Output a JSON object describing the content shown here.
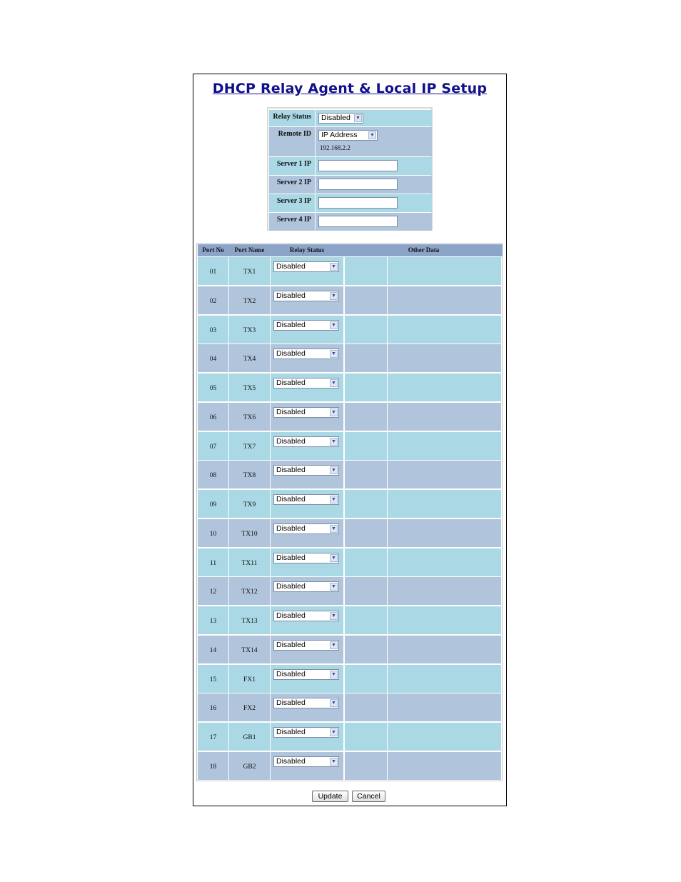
{
  "title": "DHCP Relay Agent & Local IP Setup",
  "setup": {
    "relay_status_label": "Relay Status",
    "relay_status_value": "Disabled",
    "remote_id_label": "Remote ID",
    "remote_id_type": "IP Address",
    "remote_id_value": "192.168.2.2",
    "server1_label": "Server 1 IP",
    "server2_label": "Server 2 IP",
    "server3_label": "Server 3 IP",
    "server4_label": "Server 4 IP"
  },
  "table": {
    "headers": {
      "port_no": "Port No",
      "port_name": "Port Name",
      "relay_status": "Relay Status",
      "other_data": "Other Data"
    },
    "rows": [
      {
        "port_no": "01",
        "port_name": "TX1",
        "relay_status": "Disabled"
      },
      {
        "port_no": "02",
        "port_name": "TX2",
        "relay_status": "Disabled"
      },
      {
        "port_no": "03",
        "port_name": "TX3",
        "relay_status": "Disabled"
      },
      {
        "port_no": "04",
        "port_name": "TX4",
        "relay_status": "Disabled"
      },
      {
        "port_no": "05",
        "port_name": "TX5",
        "relay_status": "Disabled"
      },
      {
        "port_no": "06",
        "port_name": "TX6",
        "relay_status": "Disabled"
      },
      {
        "port_no": "07",
        "port_name": "TX7",
        "relay_status": "Disabled"
      },
      {
        "port_no": "08",
        "port_name": "TX8",
        "relay_status": "Disabled"
      },
      {
        "port_no": "09",
        "port_name": "TX9",
        "relay_status": "Disabled"
      },
      {
        "port_no": "10",
        "port_name": "TX10",
        "relay_status": "Disabled"
      },
      {
        "port_no": "11",
        "port_name": "TX11",
        "relay_status": "Disabled"
      },
      {
        "port_no": "12",
        "port_name": "TX12",
        "relay_status": "Disabled"
      },
      {
        "port_no": "13",
        "port_name": "TX13",
        "relay_status": "Disabled"
      },
      {
        "port_no": "14",
        "port_name": "TX14",
        "relay_status": "Disabled"
      },
      {
        "port_no": "15",
        "port_name": "FX1",
        "relay_status": "Disabled"
      },
      {
        "port_no": "16",
        "port_name": "FX2",
        "relay_status": "Disabled"
      },
      {
        "port_no": "17",
        "port_name": "GB1",
        "relay_status": "Disabled"
      },
      {
        "port_no": "18",
        "port_name": "GB2",
        "relay_status": "Disabled"
      }
    ]
  },
  "buttons": {
    "update": "Update",
    "cancel": "Cancel"
  },
  "colors": {
    "row_light": "#aad8e4",
    "row_dark": "#b0c4dc",
    "header": "#8ca4c8",
    "title": "#10108a"
  },
  "icons": {
    "dropdown": "chevron-down-icon"
  }
}
